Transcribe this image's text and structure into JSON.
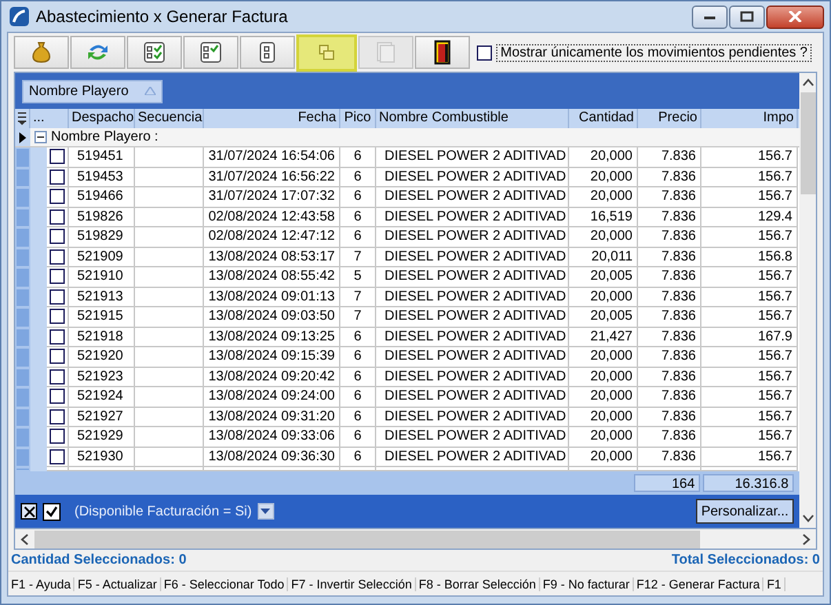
{
  "window": {
    "title": "Abastecimiento x Generar Factura"
  },
  "toolbar": {
    "buttons": [
      {
        "highlighted": false,
        "disabled": false
      },
      {
        "highlighted": false,
        "disabled": false
      },
      {
        "highlighted": false,
        "disabled": false
      },
      {
        "highlighted": false,
        "disabled": false
      },
      {
        "highlighted": false,
        "disabled": false
      },
      {
        "highlighted": true,
        "disabled": false
      },
      {
        "highlighted": false,
        "disabled": true
      },
      {
        "highlighted": false,
        "disabled": false
      }
    ],
    "pending_checkbox": {
      "label": "Mostrar únicamente los movimientos pendientes ?",
      "checked": false
    }
  },
  "group_panel": {
    "chip": "Nombre Playero"
  },
  "table": {
    "columns": [
      "...",
      "Despacho",
      "Secuencia",
      "Fecha",
      "Pico",
      "Nombre Combustible",
      "Cantidad",
      "Precio",
      "Impo"
    ],
    "group_row": {
      "label": "Nombre Playero :",
      "expanded": true
    },
    "rows": [
      {
        "checked": false,
        "despacho": "519451",
        "fecha": "31/07/2024 16:54:06",
        "pico": "6",
        "combustible": "DIESEL POWER 2 ADITIVAD",
        "cantidad": "20,000",
        "precio": "7.836",
        "importe": "156.7"
      },
      {
        "checked": false,
        "despacho": "519453",
        "fecha": "31/07/2024 16:56:22",
        "pico": "6",
        "combustible": "DIESEL POWER 2 ADITIVAD",
        "cantidad": "20,000",
        "precio": "7.836",
        "importe": "156.7"
      },
      {
        "checked": false,
        "despacho": "519466",
        "fecha": "31/07/2024 17:07:32",
        "pico": "6",
        "combustible": "DIESEL POWER 2 ADITIVAD",
        "cantidad": "20,000",
        "precio": "7.836",
        "importe": "156.7"
      },
      {
        "checked": false,
        "despacho": "519826",
        "fecha": "02/08/2024 12:43:58",
        "pico": "6",
        "combustible": "DIESEL POWER 2 ADITIVAD",
        "cantidad": "16,519",
        "precio": "7.836",
        "importe": "129.4"
      },
      {
        "checked": false,
        "despacho": "519829",
        "fecha": "02/08/2024 12:47:12",
        "pico": "6",
        "combustible": "DIESEL POWER 2 ADITIVAD",
        "cantidad": "20,000",
        "precio": "7.836",
        "importe": "156.7"
      },
      {
        "checked": false,
        "despacho": "521909",
        "fecha": "13/08/2024 08:53:17",
        "pico": "7",
        "combustible": "DIESEL POWER 2 ADITIVAD",
        "cantidad": "20,011",
        "precio": "7.836",
        "importe": "156.8"
      },
      {
        "checked": false,
        "despacho": "521910",
        "fecha": "13/08/2024 08:55:42",
        "pico": "5",
        "combustible": "DIESEL POWER 2 ADITIVAD",
        "cantidad": "20,005",
        "precio": "7.836",
        "importe": "156.7"
      },
      {
        "checked": false,
        "despacho": "521913",
        "fecha": "13/08/2024 09:01:13",
        "pico": "7",
        "combustible": "DIESEL POWER 2 ADITIVAD",
        "cantidad": "20,000",
        "precio": "7.836",
        "importe": "156.7"
      },
      {
        "checked": false,
        "despacho": "521915",
        "fecha": "13/08/2024 09:03:50",
        "pico": "7",
        "combustible": "DIESEL POWER 2 ADITIVAD",
        "cantidad": "20,005",
        "precio": "7.836",
        "importe": "156.7"
      },
      {
        "checked": false,
        "despacho": "521918",
        "fecha": "13/08/2024 09:13:25",
        "pico": "6",
        "combustible": "DIESEL POWER 2 ADITIVAD",
        "cantidad": "21,427",
        "precio": "7.836",
        "importe": "167.9"
      },
      {
        "checked": false,
        "despacho": "521920",
        "fecha": "13/08/2024 09:15:39",
        "pico": "6",
        "combustible": "DIESEL POWER 2 ADITIVAD",
        "cantidad": "20,000",
        "precio": "7.836",
        "importe": "156.7"
      },
      {
        "checked": false,
        "despacho": "521923",
        "fecha": "13/08/2024 09:20:42",
        "pico": "6",
        "combustible": "DIESEL POWER 2 ADITIVAD",
        "cantidad": "20,000",
        "precio": "7.836",
        "importe": "156.7"
      },
      {
        "checked": false,
        "despacho": "521924",
        "fecha": "13/08/2024 09:24:00",
        "pico": "6",
        "combustible": "DIESEL POWER 2 ADITIVAD",
        "cantidad": "20,000",
        "precio": "7.836",
        "importe": "156.7"
      },
      {
        "checked": false,
        "despacho": "521927",
        "fecha": "13/08/2024 09:31:20",
        "pico": "6",
        "combustible": "DIESEL POWER 2 ADITIVAD",
        "cantidad": "20,000",
        "precio": "7.836",
        "importe": "156.7"
      },
      {
        "checked": false,
        "despacho": "521929",
        "fecha": "13/08/2024 09:33:06",
        "pico": "6",
        "combustible": "DIESEL POWER 2 ADITIVAD",
        "cantidad": "20,000",
        "precio": "7.836",
        "importe": "156.7"
      },
      {
        "checked": false,
        "despacho": "521930",
        "fecha": "13/08/2024 09:36:30",
        "pico": "6",
        "combustible": "DIESEL POWER 2 ADITIVAD",
        "cantidad": "20,000",
        "precio": "7.836",
        "importe": "156.7"
      }
    ],
    "totals": {
      "cantidad": "164",
      "importe": "16.316.8"
    }
  },
  "filter_bar": {
    "enabled": true,
    "text": "(Disponible Facturación = Si)",
    "customize_button": "Personalizar..."
  },
  "summary": {
    "left": "Cantidad Seleccionados: 0",
    "right": "Total Seleccionados: 0"
  },
  "function_keys": [
    "F1 - Ayuda",
    "F5 - Actualizar",
    "F6 - Seleccionar Todo",
    "F7 - Invertir Selección",
    "F8 - Borrar Selección",
    "F9 - No facturar",
    "F12 - Generar Factura",
    "F1"
  ]
}
